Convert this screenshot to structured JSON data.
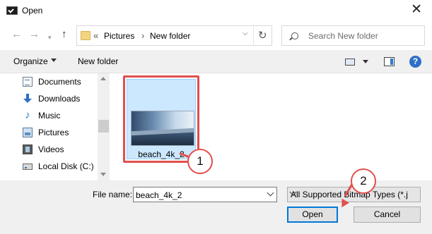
{
  "window": {
    "title": "Open"
  },
  "navigation": {
    "back_icon": "arrow-left-icon",
    "forward_icon": "arrow-right-icon",
    "recent_icon": "chevron-down-icon",
    "up_icon": "arrow-up-icon"
  },
  "address": {
    "overflow": "«",
    "crumbs": [
      "Pictures",
      "New folder"
    ]
  },
  "search": {
    "placeholder": "Search New folder"
  },
  "toolbar": {
    "organize_label": "Organize",
    "new_folder_label": "New folder"
  },
  "sidebar": {
    "items": [
      {
        "label": "Documents",
        "icon": "documents-icon"
      },
      {
        "label": "Downloads",
        "icon": "downloads-icon"
      },
      {
        "label": "Music",
        "icon": "music-icon"
      },
      {
        "label": "Pictures",
        "icon": "pictures-icon"
      },
      {
        "label": "Videos",
        "icon": "videos-icon"
      },
      {
        "label": "Local Disk (C:)",
        "icon": "disk-icon"
      }
    ]
  },
  "files": [
    {
      "name": "beach_4k_2",
      "selected": true
    }
  ],
  "bottom": {
    "file_name_label": "File name:",
    "file_name_value": "beach_4k_2",
    "file_type": "All Supported Bitmap Types (*.j",
    "open_label": "Open",
    "cancel_label": "Cancel"
  },
  "annotations": {
    "step1": "1",
    "step2": "2",
    "color": "#e0504e"
  },
  "colors": {
    "selection_fill": "#cce8ff",
    "accent": "#0078d7"
  }
}
